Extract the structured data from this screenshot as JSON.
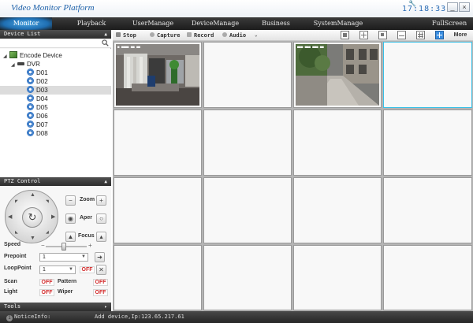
{
  "app": {
    "title": "Video Monitor Platform",
    "clock": "17:18:33"
  },
  "window": {
    "minimize": "_",
    "close": "×"
  },
  "menu": {
    "items": [
      {
        "label": "Monitor"
      },
      {
        "label": "Playback"
      },
      {
        "label": "UserManage"
      },
      {
        "label": "DeviceManage"
      },
      {
        "label": "Business"
      },
      {
        "label": "SystemManage"
      },
      {
        "label": "FullScreen"
      }
    ],
    "active": "Monitor"
  },
  "device_list": {
    "title": "Device List",
    "root": "Encode Device",
    "dvr": "DVR",
    "channels": [
      "D01",
      "D02",
      "D03",
      "D04",
      "D05",
      "D06",
      "D07",
      "D08"
    ],
    "selected": "D03"
  },
  "ptz": {
    "title": "PTZ Control",
    "zoom": "Zoom",
    "aper": "Aper",
    "focus": "Focus",
    "speed_label": "Speed",
    "speed_value": 0.45,
    "prepoint_label": "Prepoint",
    "prepoint_value": "1",
    "looppoint_label": "LoopPoint",
    "looppoint_value": "1",
    "loop_off": "OFF",
    "scan_label": "Scan",
    "scan_state": "OFF",
    "pattern_label": "Pattern",
    "pattern_state": "OFF",
    "light_label": "Light",
    "light_state": "OFF",
    "wiper_label": "Wiper",
    "wiper_state": "OFF"
  },
  "tools": {
    "title": "Tools"
  },
  "toolbar": {
    "stop": "Stop",
    "capture": "Capture",
    "record": "Record",
    "audio": "Audio",
    "more": "More"
  },
  "status": {
    "label": "NoticeInfo:",
    "message": "Add device,Ip:123.65.217.61"
  }
}
